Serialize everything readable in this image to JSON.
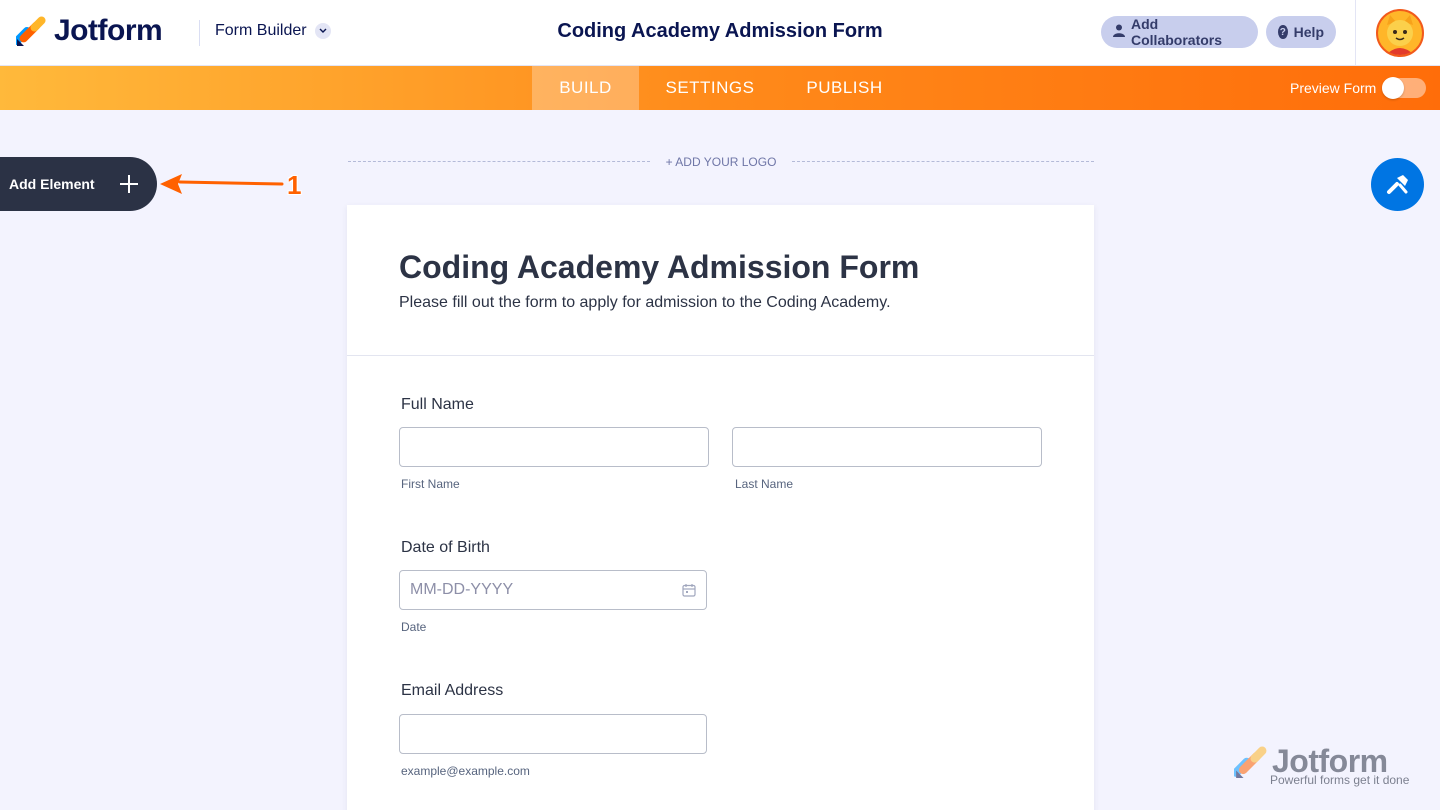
{
  "header": {
    "brand": "Jotform",
    "mode_selector": "Form Builder",
    "form_title": "Coding Academy Admission Form",
    "add_collaborators": "Add Collaborators",
    "help": "Help"
  },
  "navbar": {
    "tabs": [
      "BUILD",
      "SETTINGS",
      "PUBLISH"
    ],
    "active_tab": "BUILD",
    "preview_label": "Preview Form",
    "preview_enabled": false
  },
  "sidebar": {
    "add_element": "Add Element"
  },
  "annotation": {
    "number": "1"
  },
  "canvas": {
    "add_logo": "+ ADD YOUR LOGO"
  },
  "form": {
    "title": "Coding Academy Admission Form",
    "subtitle": "Please fill out the form to apply for admission to the Coding Academy.",
    "fields": {
      "full_name": {
        "label": "Full Name",
        "first_sublabel": "First Name",
        "last_sublabel": "Last Name"
      },
      "dob": {
        "label": "Date of Birth",
        "placeholder": "MM-DD-YYYY",
        "sublabel": "Date"
      },
      "email": {
        "label": "Email Address",
        "sublabel": "example@example.com"
      }
    }
  },
  "watermark": {
    "brand": "Jotform",
    "tagline": "Powerful forms get it done"
  },
  "colors": {
    "brand_navy": "#0a1551",
    "accent_orange": "#ff6100",
    "magic_blue": "#0075e3"
  }
}
